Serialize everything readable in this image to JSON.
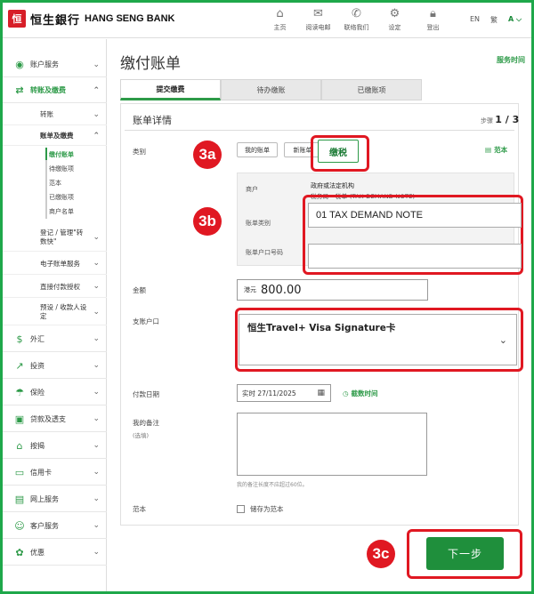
{
  "header": {
    "logo_mark": "恒",
    "logo_cn": "恒生銀行",
    "logo_en": "HANG SENG BANK",
    "nav": [
      {
        "label": "主页",
        "icon": "home-icon"
      },
      {
        "label": "阅读电邮",
        "icon": "mail-icon"
      },
      {
        "label": "联络我们",
        "icon": "phone-icon"
      },
      {
        "label": "设定",
        "icon": "gear-icon"
      },
      {
        "label": "登出",
        "icon": "lock-icon"
      }
    ],
    "lang": [
      "EN",
      "繁",
      "A"
    ]
  },
  "sidebar": {
    "items": [
      {
        "label": "账户服务",
        "icon": "account-icon"
      },
      {
        "label": "转账及缴费",
        "icon": "transfer-icon"
      },
      {
        "label": "外汇",
        "icon": "fx-icon"
      },
      {
        "label": "投资",
        "icon": "invest-icon"
      },
      {
        "label": "保险",
        "icon": "umbrella-icon"
      },
      {
        "label": "贷款及透支",
        "icon": "loan-icon"
      },
      {
        "label": "按揭",
        "icon": "house-icon"
      },
      {
        "label": "信用卡",
        "icon": "card-icon"
      },
      {
        "label": "网上服务",
        "icon": "online-icon"
      },
      {
        "label": "客户服务",
        "icon": "service-icon"
      },
      {
        "label": "优惠",
        "icon": "gift-icon"
      }
    ],
    "sub": {
      "transfer": "转账",
      "billpay": "账单及缴费",
      "leaves": [
        "缴付账单",
        "待缴账项",
        "范本",
        "已缴账项",
        "商户名单"
      ],
      "register": "登记 / 管理\"转数快\"",
      "ebill": "电子账单服务",
      "direct_debit": "直接付款授权",
      "preset": "预设 / 收款人设定"
    }
  },
  "main": {
    "title": "缴付账单",
    "service_time": "服务时间",
    "tabs": [
      "提交缴费",
      "待办缴账",
      "已缴账项"
    ],
    "section_title": "账单详情",
    "step_prefix": "步骤",
    "step_value": "1 / 3",
    "category_label": "类别",
    "chips": [
      "我的账单",
      "新账单",
      "缴税"
    ],
    "template_link": "范本",
    "merchant_label": "商户",
    "merchant_value": "政府或法定机构",
    "merchant_sub": "税务局 - 税单 (TAX DEMAND NOTE)",
    "bill_type_label": "账单类别",
    "bill_type_value": "01 TAX DEMAND NOTE",
    "bill_account_label": "账单户口号码",
    "bill_account_value": "",
    "amount_label": "金额",
    "amount_currency": "港元",
    "amount_value": "800.00",
    "pay_account_label": "支账户口",
    "pay_account_value": "恒生Travel+ Visa Signature卡",
    "date_label": "付款日期",
    "date_value": "实时 27/11/2025",
    "cutoff_link": "截数时间",
    "remark_label": "我的备注",
    "remark_optional": "(选填)",
    "remark_hint": "我的备注长度不应超过60位。",
    "template_label": "范本",
    "save_template": "储存为范本",
    "next_button": "下一步"
  },
  "annotations": [
    "3a",
    "3b",
    "3c"
  ],
  "colors": {
    "brand_green": "#2d9a48",
    "button_green": "#1f8f3c",
    "annotation_red": "#e01822",
    "logo_red": "#d71e28"
  }
}
